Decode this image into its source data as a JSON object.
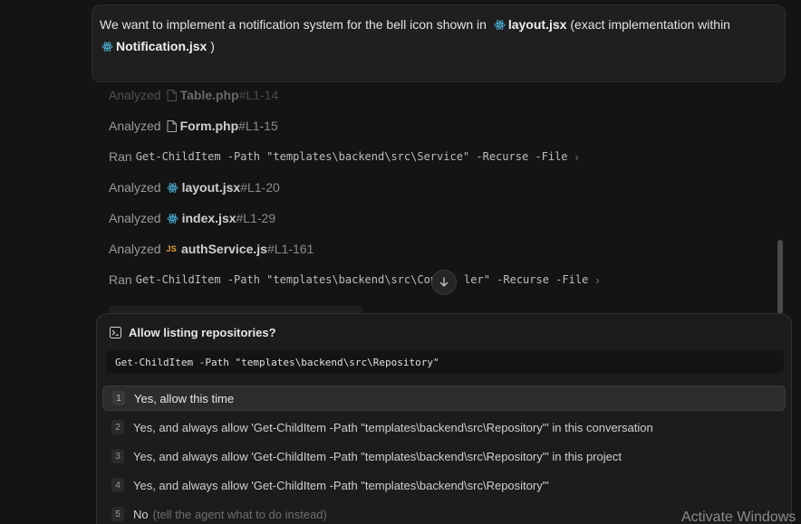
{
  "prompt": {
    "part1": "We want to implement a notification system for the bell icon shown in",
    "file1": "layout.jsx",
    "part2": "(exact implementation within",
    "file2": "Notification.jsx",
    "part3": ")"
  },
  "log": [
    {
      "verb": "Analyzed",
      "file": "Table.php",
      "range": "#L1-14"
    },
    {
      "verb": "Analyzed",
      "file": "Form.php",
      "range": "#L1-15"
    },
    {
      "verb": "Ran",
      "command": "Get-ChildItem -Path \"templates\\backend\\src\\Service\" -Recurse -File"
    },
    {
      "verb": "Analyzed",
      "file": "layout.jsx",
      "range": "#L1-20"
    },
    {
      "verb": "Analyzed",
      "file": "index.jsx",
      "range": "#L1-29"
    },
    {
      "verb": "Analyzed",
      "file": "authService.js",
      "range": "#L1-161",
      "badge": "JS"
    },
    {
      "verb": "Ran",
      "command_a": "Get-ChildItem -Path \"templates\\backend\\src\\Con",
      "command_b": "ler\" -Recurse -File"
    }
  ],
  "permission": {
    "title": "Allow listing repositories?",
    "command": "Get-ChildItem -Path \"templates\\backend\\src\\Repository\"",
    "options": [
      {
        "num": "1",
        "label": "Yes, allow this time"
      },
      {
        "num": "2",
        "label": "Yes, and always allow 'Get-ChildItem -Path \"templates\\backend\\src\\Repository\"' in this conversation"
      },
      {
        "num": "3",
        "label": "Yes, and always allow 'Get-ChildItem -Path \"templates\\backend\\src\\Repository\"' in this project"
      },
      {
        "num": "4",
        "label": "Yes, and always allow 'Get-ChildItem -Path \"templates\\backend\\src\\Repository\"'"
      },
      {
        "num": "5",
        "label": "No",
        "hint": "(tell the agent what to do instead)"
      }
    ]
  },
  "watermark": "Activate Windows",
  "colors": {
    "react": "#4fb8e0",
    "js": "#e8a13a",
    "background": "#141414"
  }
}
